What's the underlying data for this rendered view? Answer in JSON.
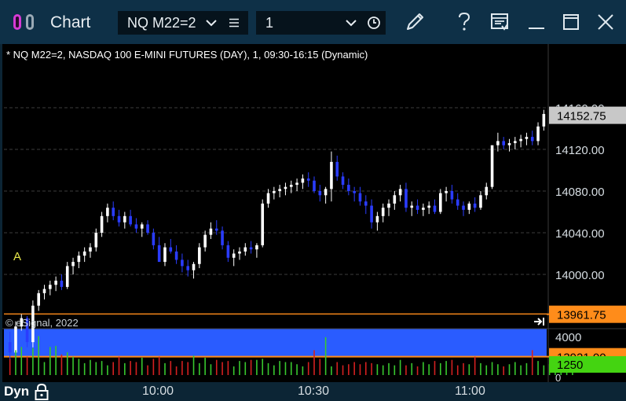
{
  "window": {
    "title": "Chart",
    "symbol": "NQ M22=2",
    "interval": "1"
  },
  "chart": {
    "header": "* NQ M22=2, NASDAQ 100 E-MINI FUTURES (DAY), 1, 09:30-16:15 (Dynamic)",
    "copyright": "© eSignal, 2022",
    "annotation": "A",
    "mode_label": "Dyn",
    "last_price_label": "14152.75",
    "zone_top_label": "13961.75",
    "zone_bottom_label": "13921.00",
    "volume_axis_top": "4000",
    "volume_axis_mid": "1250",
    "volume_axis_zero": "0",
    "colors": {
      "up": "#ffffff",
      "down": "#2a3cff",
      "zone": "#2a5cff",
      "zone_border": "#ff8c1a",
      "vol_up": "#38c82e",
      "vol_down": "#d42020"
    }
  },
  "chart_data": {
    "type": "candlestick",
    "price_ticks": [
      "14160.00",
      "14120.00",
      "14080.00",
      "14040.00",
      "14000.00"
    ],
    "time_ticks": [
      "10:00",
      "10:30",
      "11:00"
    ],
    "price_range": [
      13918,
      14165
    ],
    "volume_range": [
      0,
      4000
    ],
    "zone": {
      "high": 13961.75,
      "low": 13921.0
    },
    "bars": [
      [
        13935,
        13945,
        13918,
        13925
      ],
      [
        13925,
        13955,
        13924,
        13950
      ],
      [
        13950,
        13962,
        13946,
        13958
      ],
      [
        13958,
        13960,
        13930,
        13935
      ],
      [
        13935,
        13975,
        13930,
        13970
      ],
      [
        13970,
        13985,
        13965,
        13982
      ],
      [
        13982,
        13990,
        13976,
        13986
      ],
      [
        13986,
        13994,
        13980,
        13990
      ],
      [
        13990,
        13998,
        13984,
        13994
      ],
      [
        13994,
        14000,
        13985,
        13988
      ],
      [
        13988,
        14012,
        13986,
        14008
      ],
      [
        14008,
        14016,
        14000,
        14012
      ],
      [
        14012,
        14022,
        14006,
        14018
      ],
      [
        14018,
        14026,
        14012,
        14022
      ],
      [
        14022,
        14030,
        14016,
        14026
      ],
      [
        14026,
        14044,
        14022,
        14040
      ],
      [
        14040,
        14060,
        14036,
        14056
      ],
      [
        14056,
        14068,
        14050,
        14064
      ],
      [
        14064,
        14070,
        14052,
        14056
      ],
      [
        14056,
        14062,
        14046,
        14050
      ],
      [
        14050,
        14060,
        14044,
        14056
      ],
      [
        14056,
        14062,
        14046,
        14048
      ],
      [
        14048,
        14054,
        14040,
        14044
      ],
      [
        14044,
        14050,
        14036,
        14048
      ],
      [
        14048,
        14052,
        14038,
        14040
      ],
      [
        14040,
        14044,
        14024,
        14028
      ],
      [
        14028,
        14036,
        14020,
        14012
      ],
      [
        14012,
        14030,
        14008,
        14026
      ],
      [
        14026,
        14034,
        14020,
        14022
      ],
      [
        14022,
        14028,
        14010,
        14014
      ],
      [
        14014,
        14020,
        14002,
        14008
      ],
      [
        14008,
        14014,
        13998,
        14004
      ],
      [
        14004,
        14012,
        13996,
        14010
      ],
      [
        14010,
        14030,
        14006,
        14026
      ],
      [
        14026,
        14042,
        14022,
        14038
      ],
      [
        14038,
        14050,
        14034,
        14044
      ],
      [
        14044,
        14052,
        14038,
        14042
      ],
      [
        14042,
        14046,
        14024,
        14028
      ],
      [
        14028,
        14032,
        14012,
        14016
      ],
      [
        14016,
        14024,
        14008,
        14020
      ],
      [
        14020,
        14026,
        14014,
        14022
      ],
      [
        14022,
        14030,
        14018,
        14026
      ],
      [
        14026,
        14032,
        14020,
        14024
      ],
      [
        14024,
        14030,
        14016,
        14028
      ],
      [
        14028,
        14072,
        14026,
        14068
      ],
      [
        14068,
        14082,
        14064,
        14078
      ],
      [
        14078,
        14084,
        14072,
        14080
      ],
      [
        14080,
        14086,
        14074,
        14082
      ],
      [
        14082,
        14088,
        14076,
        14084
      ],
      [
        14084,
        14090,
        14078,
        14086
      ],
      [
        14086,
        14092,
        14080,
        14088
      ],
      [
        14088,
        14096,
        14082,
        14092
      ],
      [
        14092,
        14098,
        14084,
        14090
      ],
      [
        14090,
        14094,
        14078,
        14080
      ],
      [
        14080,
        14086,
        14070,
        14076
      ],
      [
        14076,
        14084,
        14068,
        14082
      ],
      [
        14082,
        14118,
        14070,
        14108
      ],
      [
        14108,
        14114,
        14090,
        14094
      ],
      [
        14094,
        14098,
        14082,
        14086
      ],
      [
        14086,
        14092,
        14076,
        14080
      ],
      [
        14080,
        14084,
        14070,
        14078
      ],
      [
        14078,
        14084,
        14066,
        14070
      ],
      [
        14070,
        14076,
        14058,
        14066
      ],
      [
        14066,
        14072,
        14044,
        14050
      ],
      [
        14050,
        14060,
        14042,
        14056
      ],
      [
        14056,
        14068,
        14050,
        14064
      ],
      [
        14064,
        14072,
        14056,
        14068
      ],
      [
        14068,
        14080,
        14062,
        14076
      ],
      [
        14076,
        14086,
        14070,
        14082
      ],
      [
        14082,
        14088,
        14060,
        14064
      ],
      [
        14064,
        14070,
        14056,
        14066
      ],
      [
        14066,
        14072,
        14058,
        14062
      ],
      [
        14062,
        14068,
        14056,
        14064
      ],
      [
        14064,
        14070,
        14058,
        14066
      ],
      [
        14066,
        14072,
        14058,
        14060
      ],
      [
        14060,
        14082,
        14058,
        14078
      ],
      [
        14078,
        14084,
        14070,
        14080
      ],
      [
        14080,
        14086,
        14068,
        14072
      ],
      [
        14072,
        14078,
        14062,
        14066
      ],
      [
        14066,
        14070,
        14056,
        14062
      ],
      [
        14062,
        14070,
        14058,
        14068
      ],
      [
        14068,
        14074,
        14060,
        14064
      ],
      [
        14064,
        14080,
        14062,
        14076
      ],
      [
        14076,
        14088,
        14072,
        14084
      ],
      [
        14084,
        14104,
        14082,
        14124
      ],
      [
        14124,
        14136,
        14118,
        14128
      ],
      [
        14128,
        14132,
        14120,
        14124
      ],
      [
        14124,
        14130,
        14118,
        14126
      ],
      [
        14126,
        14132,
        14120,
        14128
      ],
      [
        14128,
        14134,
        14122,
        14130
      ],
      [
        14130,
        14136,
        14124,
        14132
      ],
      [
        14132,
        14138,
        14124,
        14128
      ],
      [
        14128,
        14146,
        14124,
        14142
      ],
      [
        14142,
        14158,
        14138,
        14154
      ]
    ],
    "volume": [
      1500,
      2300,
      2600,
      1700,
      2500,
      3600,
      1200,
      2600,
      2700,
      1900,
      2100,
      1700,
      1500,
      1100,
      1400,
      1200,
      1300,
      900,
      1200,
      1700,
      1100,
      1300,
      1200,
      1600,
      900,
      1500,
      1700,
      1100,
      1300,
      800,
      1300,
      1200,
      1800,
      1100,
      1600,
      1000,
      1400,
      1200,
      1300,
      800,
      1300,
      1200,
      1400,
      1400,
      1500,
      1100,
      900,
      1300,
      1200,
      1200,
      1000,
      800,
      1200,
      2300,
      1500,
      3500,
      800,
      1200,
      900,
      1000,
      1200,
      1000,
      1200,
      1100,
      1000,
      900,
      1100,
      900,
      1400,
      900,
      1100,
      800,
      1200,
      1000,
      1300,
      1100,
      1300,
      1400,
      900,
      1100,
      1000,
      1700,
      1100,
      900,
      1200,
      1000,
      800,
      1000,
      1200,
      900,
      1100,
      2300,
      1300,
      900,
      1000,
      1100,
      1000,
      1200,
      1300
    ]
  }
}
